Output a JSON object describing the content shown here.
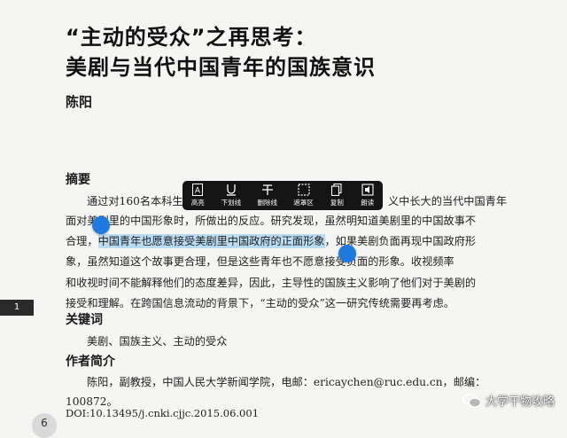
{
  "article": {
    "title_line1": "“主动的受众”之再思考：",
    "title_line2": "美剧与当代中国青年的国族意识",
    "author": "陈阳",
    "abstract_heading": "摘要",
    "abstract_lines": [
      "通过对160名本科生",
      "义中长大的当代中国青年",
      "面对美剧里的中国形象时，所做出的反应。研究发现，虽然明知道美剧里的中国故事不",
      "合理，",
      "中国青年也愿意接受美剧里中国政府的正面形象",
      "，如果美剧负面再现中国政府形",
      "象，虽然知道这个故事更合理，但是这些青年也不愿意接受负面的形象。收视频率",
      "和收视时间不能解释他们的态度差异，因此，主导性的国族主义影响了他们对于美剧的",
      "接受和理解。在跨国信息流动的背景下，“主动的受众”这一研究传统需要再考虑。"
    ],
    "keywords_heading": "关键词",
    "keywords": "美剧、国族主义、主动的受众",
    "bio_heading": "作者简介",
    "bio_line1": "陈阳，副教授，中国人民大学新闻学院，电邮：ericaychen@ruc.edu.cn，邮编：",
    "bio_line2": "100872。",
    "doi": "DOI:10.13495/j.cnki.cjjc.2015.06.001"
  },
  "page_indicator": "1",
  "corner_badge": "6",
  "selection_toolbar": {
    "items": [
      {
        "label": "高亮",
        "icon": "highlight-icon"
      },
      {
        "label": "下划线",
        "icon": "underline-icon"
      },
      {
        "label": "删除线",
        "icon": "strikethrough-icon"
      },
      {
        "label": "遮罩区",
        "icon": "mask-area-icon"
      },
      {
        "label": "复制",
        "icon": "copy-icon"
      },
      {
        "label": "朗读",
        "icon": "read-aloud-icon"
      }
    ]
  },
  "watermark": {
    "text": "大学干物攻略",
    "icon": "wechat-icon"
  },
  "colors": {
    "highlight": "#b9dcf3",
    "handle": "#1f7ae0",
    "toolbar": "#141414"
  }
}
